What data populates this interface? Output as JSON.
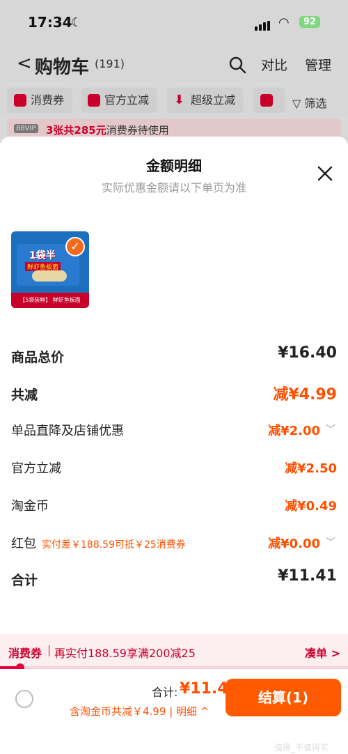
{
  "status": {
    "time": "17:34",
    "battery": "92"
  },
  "header": {
    "back": "<",
    "title": "购物车",
    "count": "(191)",
    "compare": "对比",
    "manage": "管理"
  },
  "chips": [
    {
      "label": "消费券"
    },
    {
      "label": "官方立减"
    },
    {
      "label": "超级立减"
    },
    {
      "label": "筛选"
    }
  ],
  "vip": {
    "badge": "88VIP",
    "highlight": "3张共285元",
    "text": "消费券待使用"
  },
  "sheet": {
    "title": "金额明细",
    "subtitle": "实际优惠金额请以下单页为准",
    "product": {
      "brand": "1袋半",
      "flavor": "鲜虾鱼板面",
      "footer": "【5袋装鲜】 鲜虾鱼板面"
    },
    "rows": {
      "total_price": {
        "label": "商品总价",
        "value": "¥16.40"
      },
      "total_discount": {
        "label": "共减",
        "value": "减¥4.99"
      },
      "store_discount": {
        "label": "单品直降及店铺优惠",
        "value": "减¥2.00"
      },
      "official_discount": {
        "label": "官方立减",
        "value": "减¥2.50"
      },
      "coins": {
        "label": "淘金币",
        "value": "减¥0.49"
      },
      "redpacket": {
        "label": "红包",
        "note": "实付差￥188.59可抵￥25消费券",
        "value": "减¥0.00"
      },
      "sum": {
        "label": "合计",
        "value": "¥11.41"
      }
    }
  },
  "couponbar": {
    "label": "消费券",
    "message": "再实付188.59享满200减25",
    "action": "凑单 >",
    "progress": 0.05
  },
  "bottom": {
    "total_label": "合计:",
    "total_value": "¥11.41",
    "sub": "含淘金币共减￥4.99",
    "detail": "| 明细 ^",
    "pay": "结算(1)",
    "watermark": "值得_不值得买"
  }
}
